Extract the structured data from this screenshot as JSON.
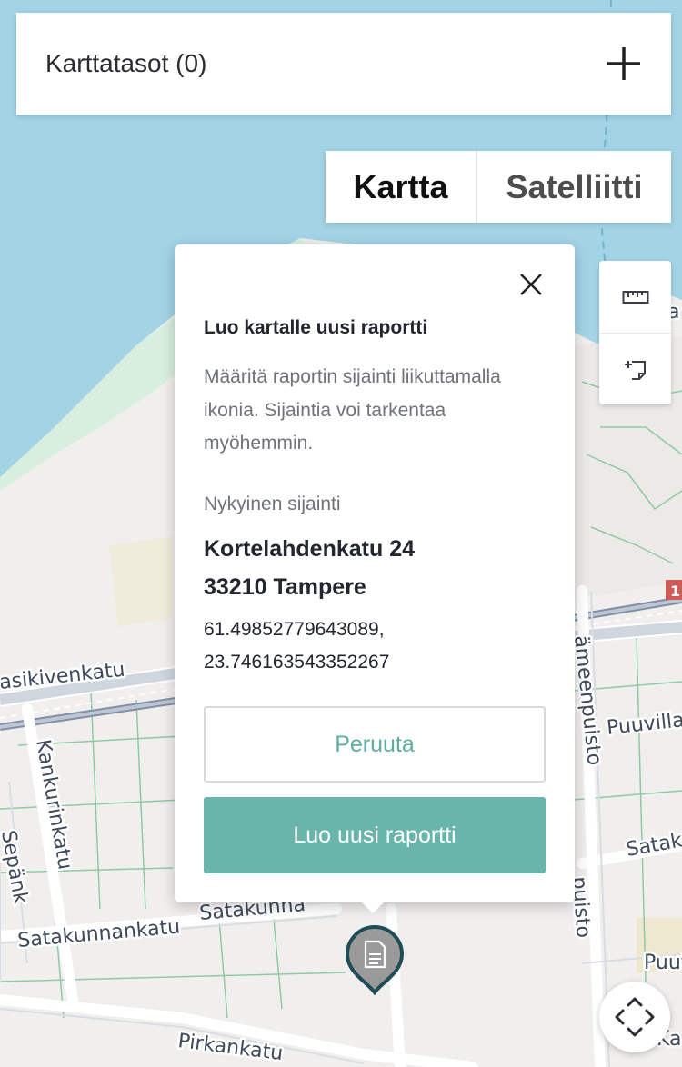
{
  "layers": {
    "title": "Karttatasot (0)",
    "add_icon": "plus-icon"
  },
  "map_type": {
    "options": [
      "Kartta",
      "Satelliitti"
    ],
    "selected": "Kartta"
  },
  "tools": {
    "items": [
      {
        "icon": "ruler-icon"
      },
      {
        "icon": "add-note-icon"
      }
    ]
  },
  "map": {
    "streets": [
      "asikivenkatu",
      "Kankurinkatu",
      "Satakunnankatu",
      "Satakunna",
      "Pirkankatu",
      "ämeenpuisto",
      "Puuvillat",
      "Satak",
      "puisto",
      "Puut",
      "Ka",
      "Sepänk",
      "a"
    ],
    "route_badge": "1",
    "colors": {
      "water": "#a3d4e6",
      "land": "#f1efee",
      "park": "#dcefe2"
    }
  },
  "popup": {
    "title": "Luo kartalle uusi raportti",
    "description": "Määritä raportin sijainti liikuttamalla ikonia. Sijaintia voi tarkentaa myöhemmin.",
    "location_label": "Nykyinen sijainti",
    "address_line1": "Kortelahdenkatu 24",
    "address_line2": "33210 Tampere",
    "coord_lat": "61.49852779643089,",
    "coord_lon": "23.746163543352267",
    "cancel_label": "Peruuta",
    "create_label": "Luo uusi raportti",
    "accent_color": "#69b5ab"
  },
  "marker": {
    "icon": "document-marker-icon"
  },
  "pan": {
    "icon": "pan-arrows-icon"
  }
}
